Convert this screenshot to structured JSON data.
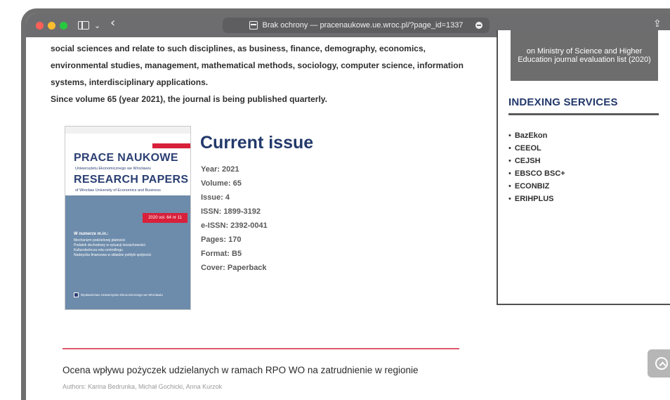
{
  "browser": {
    "address_text": "Brak ochrony — pracenaukowe.ue.wroc.pl/?page_id=1337",
    "back_glyph": "‹",
    "chevron_glyph": "⌄",
    "share_glyph": "⇪",
    "traffic_colors": [
      "#ff5f57",
      "#febc2e",
      "#28c840"
    ]
  },
  "intro": {
    "lines": [
      "social sciences and relate to such disciplines, as business, finance, demography, economics,",
      "environmental studies, management, mathematical methods, sociology, computer science, information",
      "systems, interdisciplinary applications.",
      "Since volume 65 (year 2021), the journal is being published quarterly."
    ]
  },
  "cover": {
    "title1": "PRACE NAUKOWE",
    "subtitle1": "Uniwersytetu Ekonomicznego we Wrocławiu",
    "title2": "RESEARCH PAPERS",
    "subtitle2": "of Wrocław University of Economics and Business",
    "issue_label": "2020 vol. 64 nr 11",
    "contents_heading": "W numerze m.in.:",
    "contents": [
      "Mechanizm podzielonej płatności",
      "Podatek dochodowy w sytuacji niezachowości",
      "Kulturotwórcza rola controllingu",
      "Nadwyżka finansowa w składzie polityki spójności"
    ],
    "publisher": "Wydawnictwo Uniwersytetu Ekonomicznego we Wrocławiu"
  },
  "current_issue": {
    "heading": "Current issue",
    "details": [
      "Year: 2021",
      "Volume: 65",
      "Issue: 4",
      "ISSN: 1899-3192",
      "e-ISSN: 2392-0041",
      "Pages: 170",
      "Format: B5",
      "Cover: Paperback"
    ]
  },
  "sidebar": {
    "evaluation_text": "on Ministry of Science and Higher Education journal evaluation list (2020)",
    "indexing_title": "INDEXING SERVICES",
    "indexing_items": [
      "BazEkon",
      "CEEOL",
      "CEJSH",
      "EBSCO BSC+",
      "ECONBIZ",
      "ERIHPLUS"
    ]
  },
  "article": {
    "title": "Ocena wpływu pożyczek udzielanych w ramach RPO WO na zatrudnienie w regionie",
    "authors": "Authors: Karina Bedrunka, Michał Gochicki, Anna Kurzok"
  },
  "colors": {
    "accent_navy": "#23396b",
    "accent_red": "#d8203a",
    "rule_red": "#e05a6e"
  }
}
